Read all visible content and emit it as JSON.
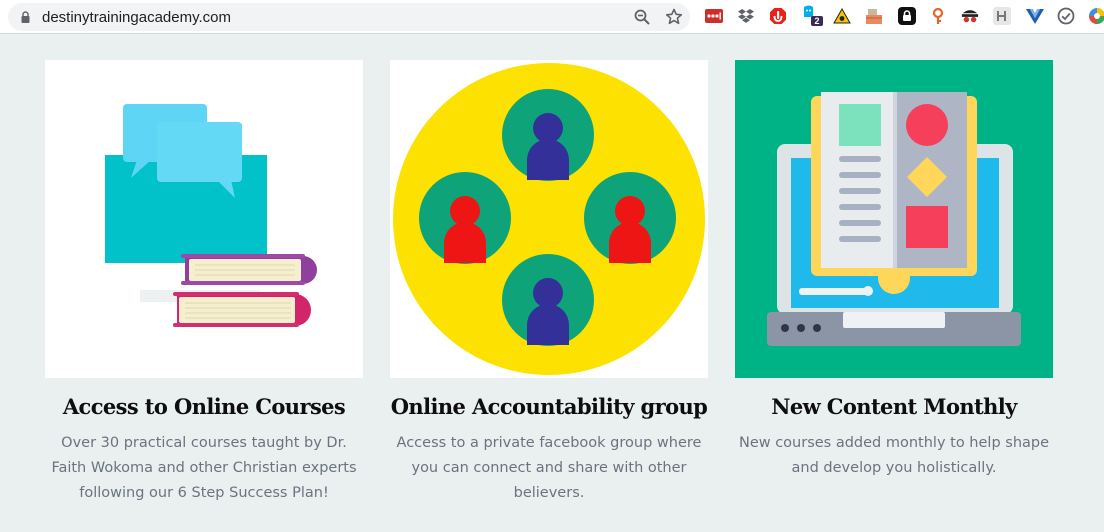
{
  "browser": {
    "url": "destinytrainingacademy.com",
    "extension_badge": "2",
    "icons": [
      "lock-icon",
      "zoom-out-icon",
      "bookmark-star-icon"
    ],
    "extensions": [
      "lastpass-icon",
      "dropbox-icon",
      "adblock-icon",
      "ghostery-icon",
      "warning-icon",
      "archive-icon",
      "privacy-icon",
      "bitwarden-icon",
      "disguise-icon",
      "grammarly-icon",
      "vue-icon",
      "check-icon",
      "color-wheel-icon"
    ]
  },
  "cards": [
    {
      "illustration": "online-courses-illustration",
      "title": "Access to Online Courses",
      "description": "Over 30 practical courses taught by Dr. Faith Wokoma and other Christian experts following our 6 Step Success Plan!"
    },
    {
      "illustration": "accountability-group-illustration",
      "title": "Online Accountability group",
      "description": "Access to a private facebook group where you can connect and share with other believers."
    },
    {
      "illustration": "monthly-content-illustration",
      "title": "New Content Monthly",
      "description": "New courses added monthly to help shape and develop you holistically."
    }
  ],
  "colors": {
    "page_bg": "#eaeff0",
    "yellow": "#fde100",
    "green": "#00b386",
    "teal": "#00c2c8"
  }
}
